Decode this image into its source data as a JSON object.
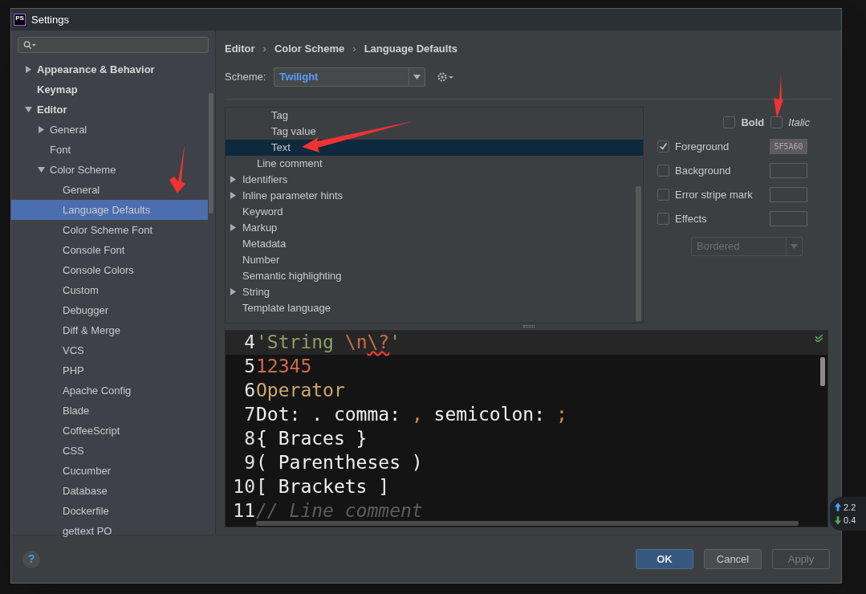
{
  "window": {
    "title": "Settings",
    "app_icon": "PS"
  },
  "sidebar": {
    "items": [
      {
        "label": "Appearance & Behavior",
        "expanded": false,
        "selected": false
      },
      {
        "label": "Keymap",
        "selected": false
      },
      {
        "label": "Editor",
        "expanded": true,
        "selected": false,
        "children": [
          {
            "label": "General",
            "expanded": false,
            "selected": false
          },
          {
            "label": "Font",
            "selected": false
          },
          {
            "label": "Color Scheme",
            "expanded": true,
            "selected": false,
            "children": [
              {
                "label": "General",
                "selected": false
              },
              {
                "label": "Language Defaults",
                "selected": true
              },
              {
                "label": "Color Scheme Font",
                "selected": false
              },
              {
                "label": "Console Font",
                "selected": false
              },
              {
                "label": "Console Colors",
                "selected": false
              },
              {
                "label": "Custom",
                "selected": false
              },
              {
                "label": "Debugger",
                "selected": false
              },
              {
                "label": "Diff & Merge",
                "selected": false
              },
              {
                "label": "VCS",
                "selected": false
              },
              {
                "label": "PHP",
                "selected": false
              },
              {
                "label": "Apache Config",
                "selected": false
              },
              {
                "label": "Blade",
                "selected": false
              },
              {
                "label": "CoffeeScript",
                "selected": false
              },
              {
                "label": "CSS",
                "selected": false
              },
              {
                "label": "Cucumber",
                "selected": false
              },
              {
                "label": "Database",
                "selected": false
              },
              {
                "label": "Dockerfile",
                "selected": false
              },
              {
                "label": "gettext PO",
                "selected": false
              }
            ]
          }
        ]
      }
    ]
  },
  "breadcrumb": {
    "separator": "›",
    "items": [
      "Editor",
      "Color Scheme",
      "Language Defaults"
    ]
  },
  "scheme": {
    "label": "Scheme:",
    "value": "Twilight"
  },
  "elements_tree": [
    {
      "children": [
        {
          "children": [
            {
              "label": "Tag",
              "selected": false
            },
            {
              "label": "Tag value",
              "selected": false
            },
            {
              "label": "Text",
              "selected": true
            }
          ]
        },
        {
          "label": "Line comment",
          "selected": false
        }
      ]
    },
    {
      "label": "Identifiers",
      "expanded": false,
      "selected": false
    },
    {
      "label": "Inline parameter hints",
      "expanded": false,
      "selected": false
    },
    {
      "label": "Keyword",
      "selected": false
    },
    {
      "label": "Markup",
      "expanded": false,
      "selected": false
    },
    {
      "label": "Metadata",
      "selected": false
    },
    {
      "label": "Number",
      "selected": false
    },
    {
      "label": "Semantic highlighting",
      "selected": false
    },
    {
      "label": "String",
      "expanded": false,
      "selected": false
    },
    {
      "label": "Template language",
      "selected": false
    }
  ],
  "font_style": [
    {
      "label": "Bold",
      "checked": false
    },
    {
      "label": "Italic",
      "checked": false
    }
  ],
  "attributes": [
    {
      "label": "Foreground",
      "checked": true,
      "value": "5F5A60",
      "color": "#5f5a60"
    },
    {
      "label": "Background",
      "checked": false
    },
    {
      "label": "Error stripe mark",
      "checked": false
    },
    {
      "label": "Effects",
      "checked": false
    }
  ],
  "effect_type": {
    "value": "Bordered",
    "disabled": true
  },
  "preview": {
    "lines": [
      {
        "number": "4",
        "current": true,
        "segments": [
          {
            "text": "'String ",
            "kind": "string"
          },
          {
            "text": "\\n",
            "kind": "escape"
          },
          {
            "text": "\\?",
            "kind": "bad_escape"
          },
          {
            "text": "'",
            "kind": "string"
          }
        ]
      },
      {
        "number": "5",
        "current": false,
        "segments": [
          {
            "text": "12345",
            "kind": "number"
          }
        ]
      },
      {
        "number": "6",
        "current": false,
        "segments": [
          {
            "text": "Operator",
            "kind": "operator"
          }
        ]
      },
      {
        "number": "7",
        "current": false,
        "segments": [
          {
            "text": "Dot: . comma: ",
            "kind": "plain"
          },
          {
            "text": ",",
            "kind": "punct"
          },
          {
            "text": " semicolon: ",
            "kind": "plain"
          },
          {
            "text": ";",
            "kind": "punct"
          }
        ]
      },
      {
        "number": "8",
        "current": false,
        "segments": [
          {
            "text": "{ Braces }",
            "kind": "plain"
          }
        ]
      },
      {
        "number": "9",
        "current": false,
        "segments": [
          {
            "text": "( Parentheses )",
            "kind": "plain"
          }
        ]
      },
      {
        "number": "10",
        "current": false,
        "segments": [
          {
            "text": "[ Brackets ]",
            "kind": "plain"
          }
        ]
      },
      {
        "number": "11",
        "current": false,
        "segments": [
          {
            "text": "// Line comment",
            "kind": "comment"
          }
        ]
      }
    ]
  },
  "help": {
    "label": "?"
  },
  "buttons": [
    {
      "label": "OK",
      "kind": "primary",
      "disabled": false
    },
    {
      "label": "Cancel",
      "kind": "normal",
      "disabled": false
    },
    {
      "label": "Apply",
      "kind": "normal",
      "disabled": true
    }
  ],
  "network_meter": {
    "upload": "2.2",
    "download": "0.4"
  }
}
